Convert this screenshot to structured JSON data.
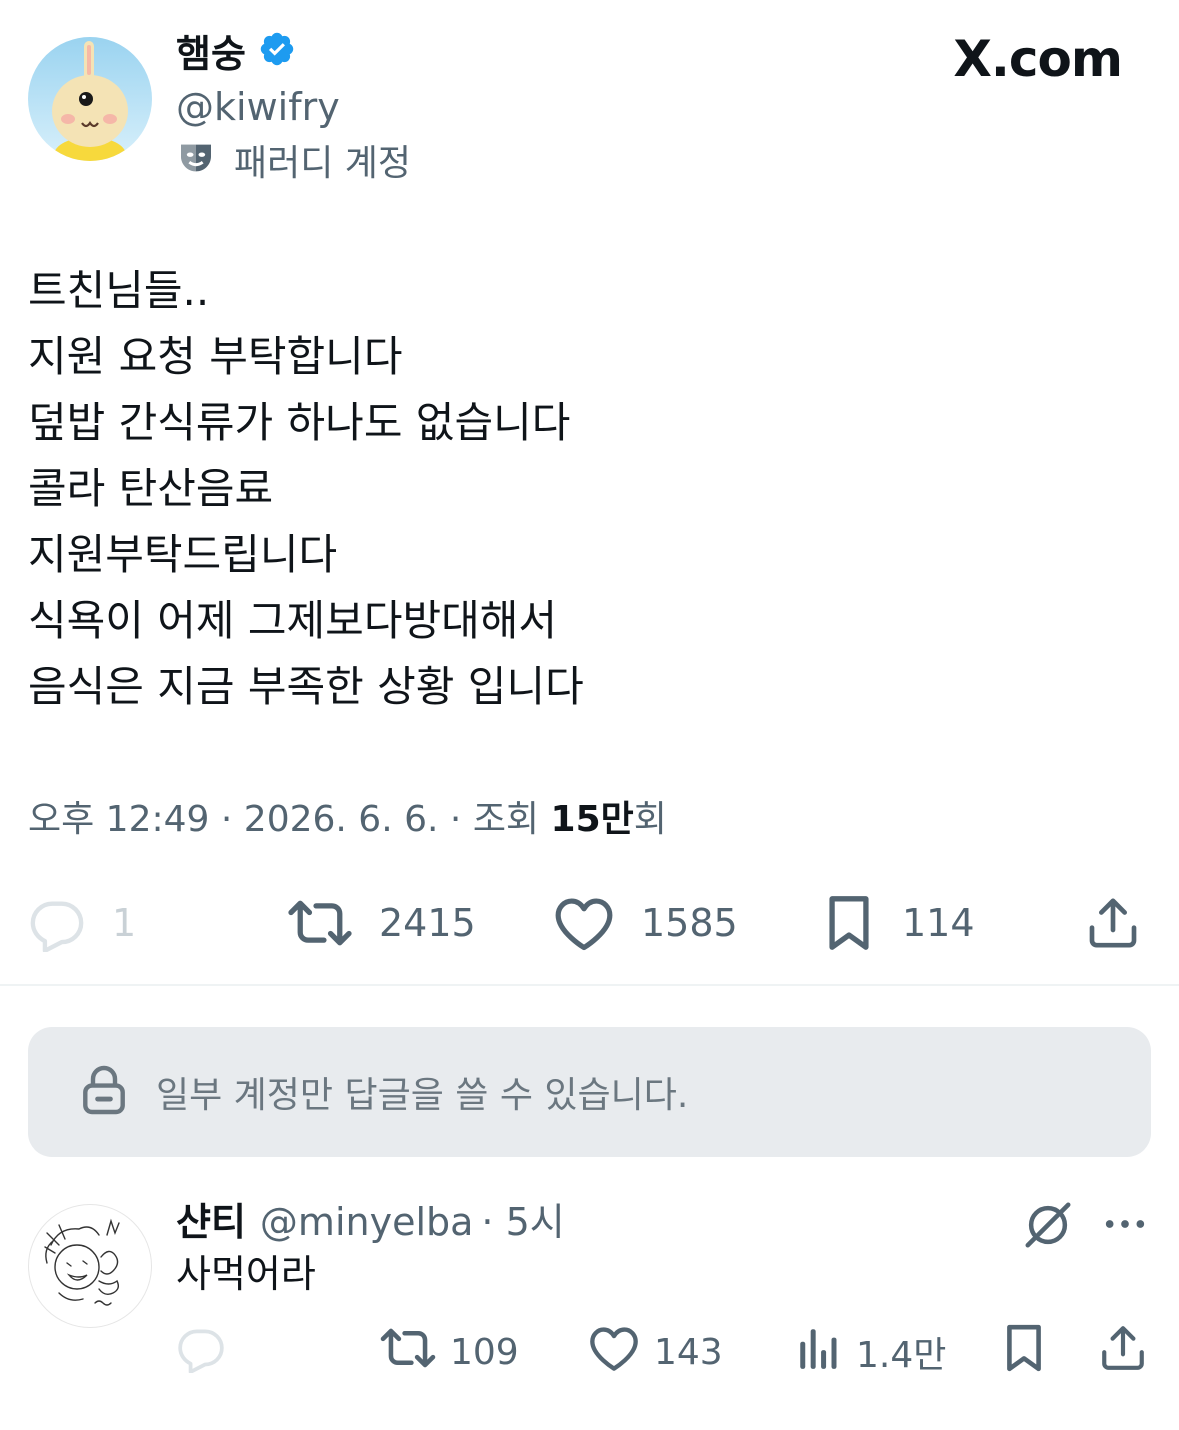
{
  "tweet": {
    "author": {
      "display_name": "햄숭",
      "handle": "@kiwifry",
      "parody_label": "패러디 계정"
    },
    "brand": "X.com",
    "lines": [
      "트친님들..",
      "지원 요청 부탁합니다",
      "덮밥 간식류가 하나도 없습니다",
      "콜라 탄산음료",
      "지원부탁드립니다",
      "식욕이 어제 그제보다방대해서",
      "음식은 지금 부족한 상황 입니다"
    ],
    "meta": {
      "time": "오후 12:49",
      "date": "2026. 6. 6.",
      "views_label": "조회",
      "views_count": "15만",
      "views_suffix": "회",
      "sep": "·"
    },
    "stats": {
      "replies": "1",
      "reposts": "2415",
      "likes": "1585",
      "bookmarks": "114"
    }
  },
  "restriction_notice": "일부 계정만 답글을 쓸 수 있습니다.",
  "reply": {
    "display_name": "샨티",
    "handle": "@minyelba",
    "time": "· 5시",
    "text": "사먹어라",
    "stats": {
      "reposts": "109",
      "likes": "143",
      "views": "1.4만"
    }
  },
  "colors": {
    "verified": "#1d9bf0",
    "muted": "#536471",
    "text": "#0f1419",
    "notice_bg": "#e8ebee"
  },
  "icons": [
    "verified-badge-icon",
    "parody-mask-icon",
    "reply-icon",
    "repost-icon",
    "like-icon",
    "bookmark-icon",
    "share-icon",
    "lock-icon",
    "grok-icon",
    "more-icon",
    "views-icon"
  ]
}
